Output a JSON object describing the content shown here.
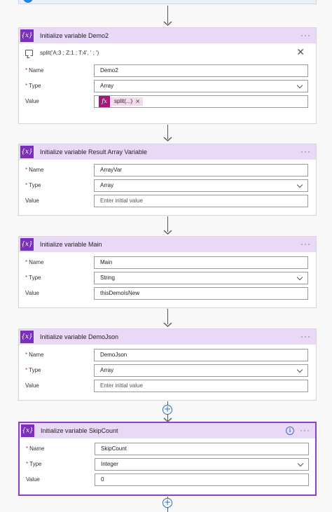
{
  "cards": [
    {
      "title": "Initialize variable Demo2",
      "icon": "variable-icon",
      "icon_text": "{x}",
      "menu_label": "···",
      "expression": "split('A:3 ; Z:1 ; T:4', ' ; ')",
      "close_label": "✕",
      "name_label": "Name",
      "type_label": "Type",
      "value_label": "Value",
      "name": "Demo2",
      "type": "Array",
      "value_token": "split(...)",
      "value_token_icon": "fx",
      "value_token_remove": "×"
    },
    {
      "title": "Initialize variable Result Array Variable",
      "icon_text": "{x}",
      "menu_label": "···",
      "name_label": "Name",
      "type_label": "Type",
      "value_label": "Value",
      "name": "ArrayVar",
      "type": "Array",
      "value_placeholder": "Enter initial value"
    },
    {
      "title": "Initialize variable Main",
      "icon_text": "{x}",
      "menu_label": "···",
      "name_label": "Name",
      "type_label": "Type",
      "value_label": "Value",
      "name": "Main",
      "type": "String",
      "value": "thisDemoIsNew"
    },
    {
      "title": "Initialize variable DemoJson",
      "icon_text": "{x}",
      "menu_label": "···",
      "name_label": "Name",
      "type_label": "Type",
      "value_label": "Value",
      "name": "DemoJson",
      "type": "Array",
      "value_placeholder": "Enter initial value"
    },
    {
      "title": "Initialize variable SkipCount",
      "icon_text": "{x}",
      "menu_label": "···",
      "info_label": "i",
      "name_label": "Name",
      "type_label": "Type",
      "value_label": "Value",
      "name": "SkipCount",
      "type": "Integer",
      "value": "0"
    }
  ],
  "required_marker": "*",
  "add_step_label": "+",
  "colors": {
    "variable_accent": "#7b2fbe",
    "header_bg": "#ead9f6",
    "selected_border": "#8c3fc7",
    "expression_token": "#a3177d",
    "add_button": "#2b6bb8"
  }
}
